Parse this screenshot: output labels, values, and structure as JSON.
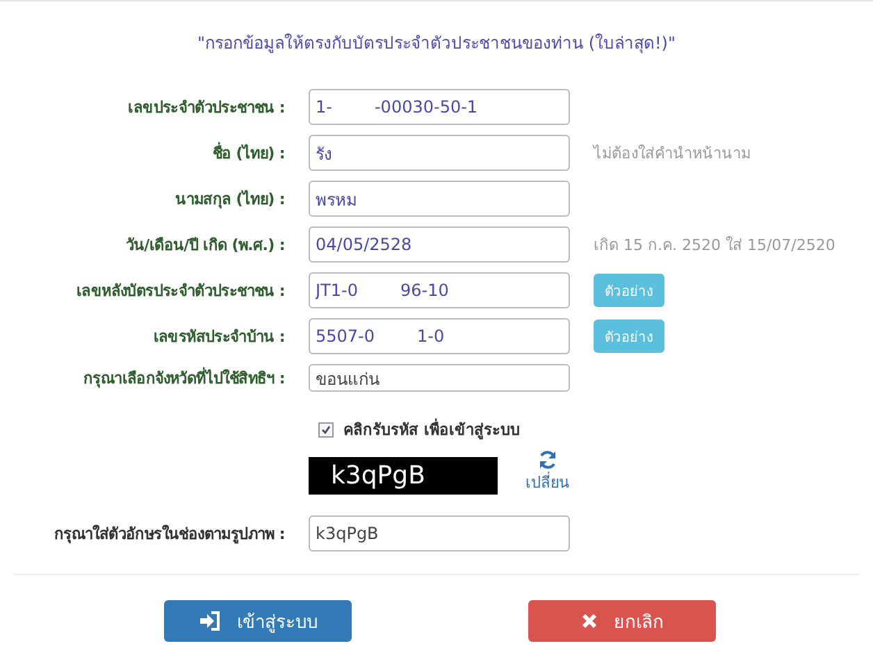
{
  "heading": "\"กรอกข้อมูลให้ตรงกับบัตรประจำตัวประชาชนของท่าน (ใบล่าสุด!)\"",
  "rows": [
    {
      "kind": "field",
      "label": "เลขประจำตัวประชาชน :",
      "value": "1-        -00030-50-1"
    },
    {
      "kind": "field",
      "label": "ชื่อ (ไทย) :",
      "value": "รัง",
      "hint": "ไม่ต้องใส่คำนำหน้านาม"
    },
    {
      "kind": "field",
      "label": "นามสกุล (ไทย) :",
      "value": "พรหม"
    },
    {
      "kind": "field",
      "label": "วัน/เดือน/ปี เกิด (พ.ศ.) :",
      "value": "04/05/2528",
      "hint": "เกิด 15 ก.ค. 2520 ใส่ 15/07/2520"
    },
    {
      "kind": "field",
      "label": "เลขหลังบัตรประจำตัวประชาชน :",
      "value": "JT1-0        96-10",
      "button": "ตัวอย่าง"
    },
    {
      "kind": "field",
      "label": "เลขรหัสประจำบ้าน :",
      "value": "5507-0        1-0",
      "button": "ตัวอย่าง"
    },
    {
      "kind": "select",
      "label": "กรุณาเลือกจังหวัดที่ไปใช้สิทธิฯ :",
      "value": "ขอนแก่น"
    }
  ],
  "consent": {
    "label": "คลิกรับรหัส เพื่อเข้าสู่ระบบ",
    "checked": true
  },
  "captcha": {
    "code": "k3qPgB",
    "refresh": "เปลี่ยน"
  },
  "captcha_input": {
    "label": "กรุณาใส่ตัวอักษรในช่องตามรูปภาพ :",
    "value": "k3qPgB"
  },
  "buttons": [
    {
      "kind": "login",
      "label": "เข้าสู่ระบบ"
    },
    {
      "kind": "cancel",
      "label": "ยกเลิก"
    }
  ]
}
